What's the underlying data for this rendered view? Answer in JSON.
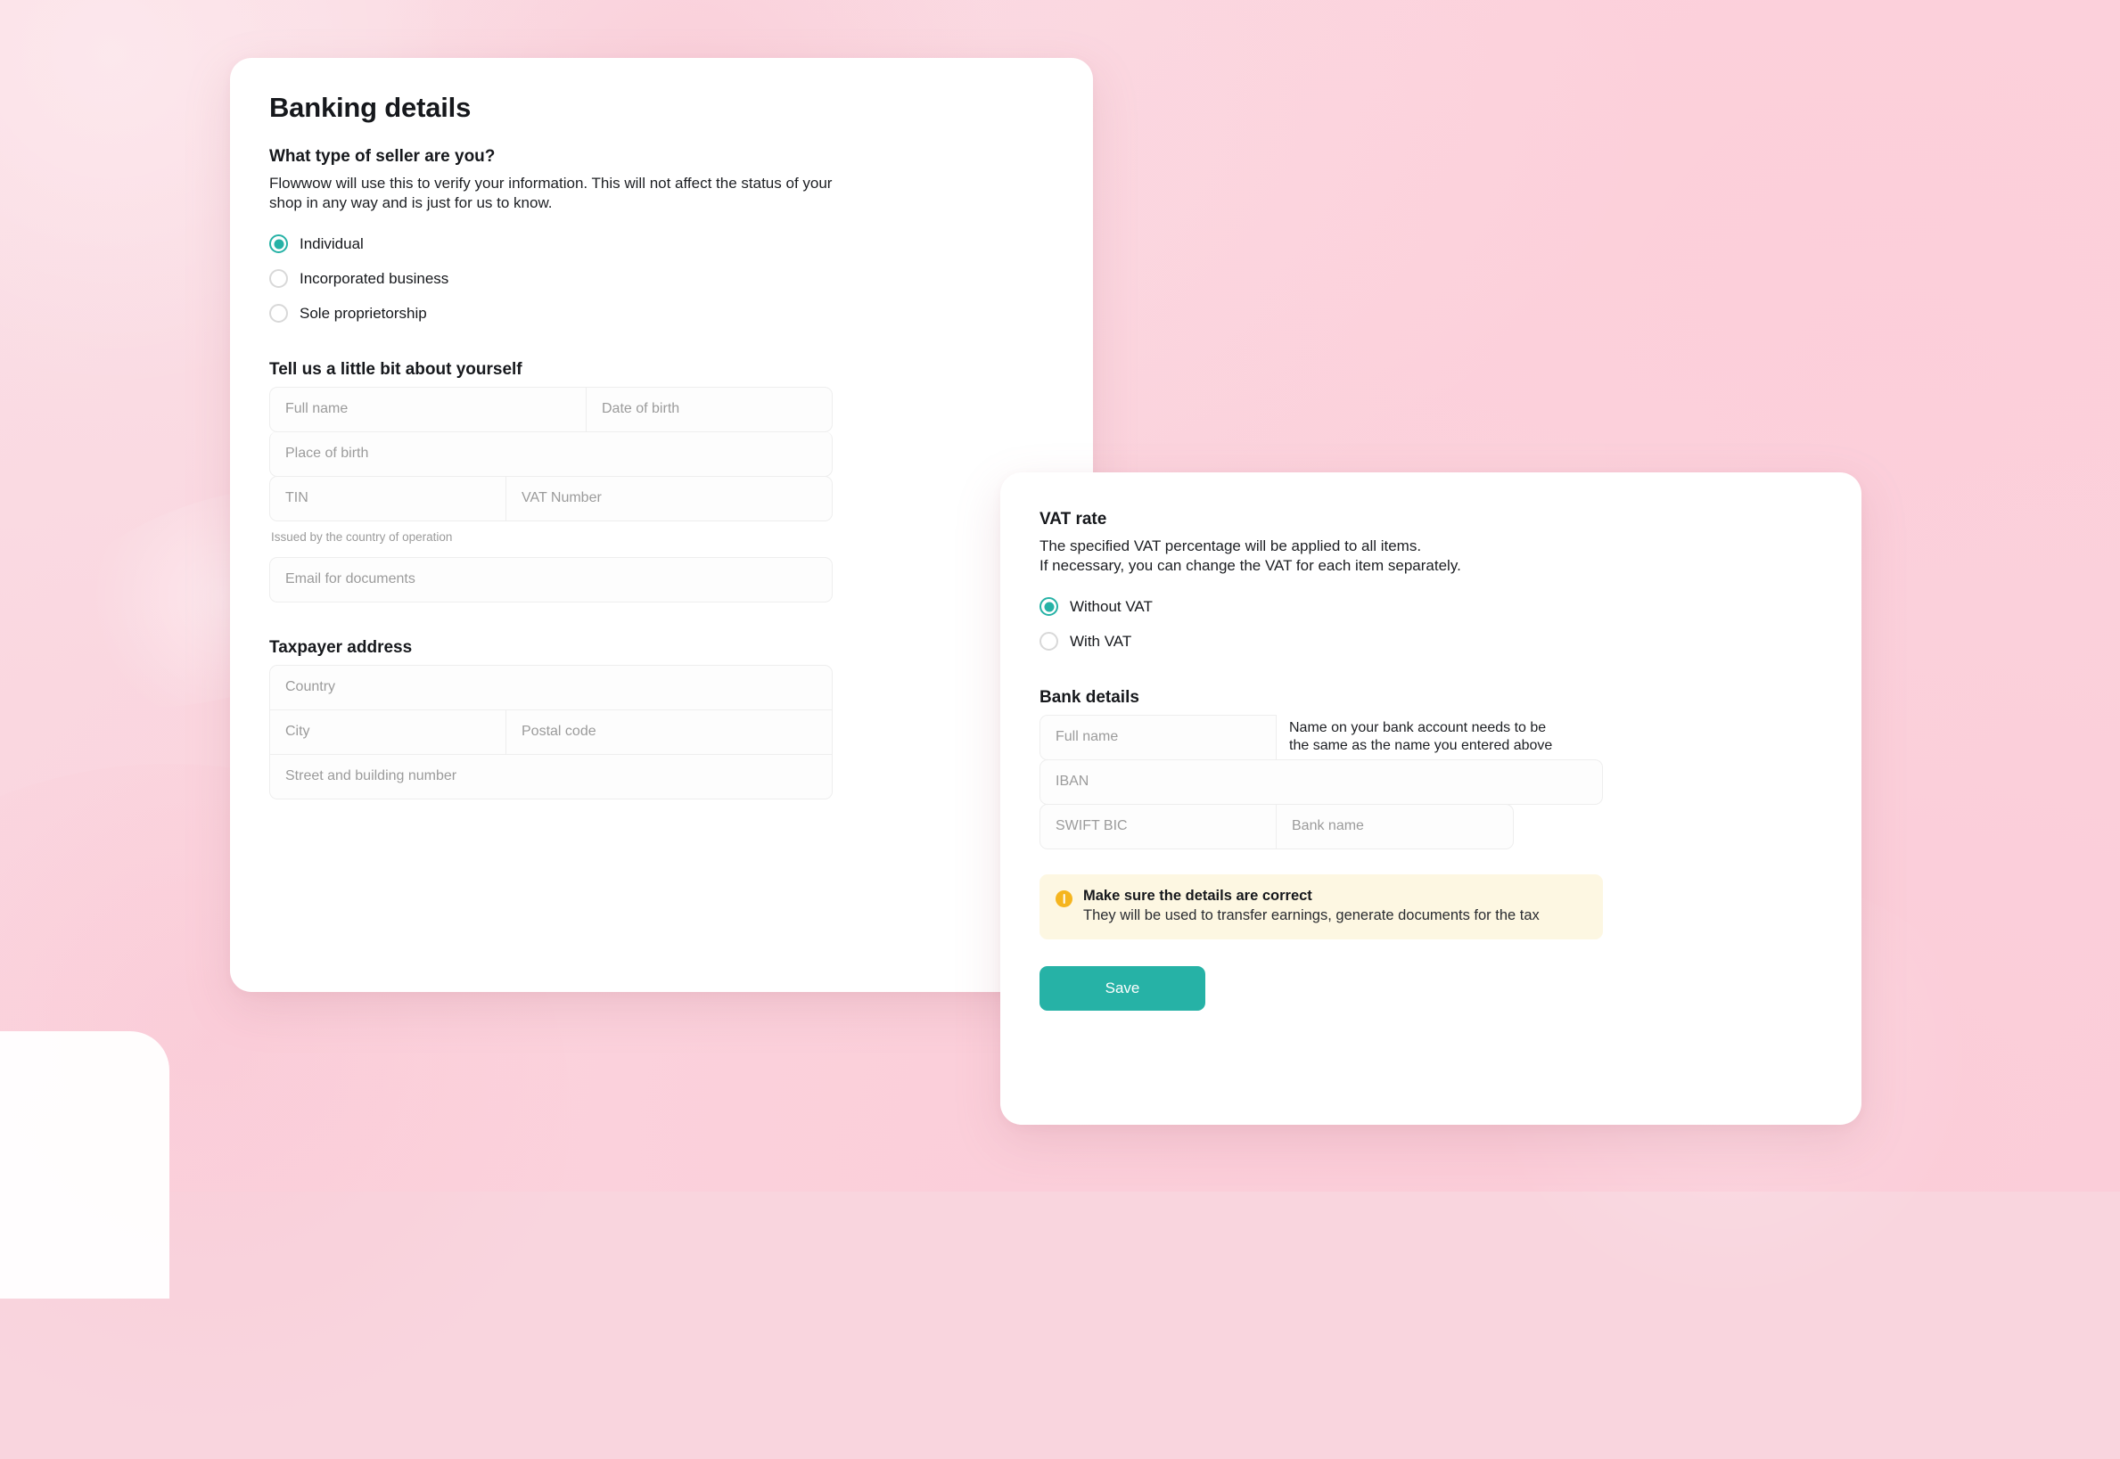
{
  "theme": {
    "accent": "#26b2a6",
    "warning_icon": "#f5b51f",
    "warning_bg": "#fdf7e2",
    "background_pink": "#f9d5de",
    "card_bg": "#ffffff",
    "placeholder": "#9b9b9b"
  },
  "banking_card": {
    "title": "Banking details",
    "seller_type": {
      "heading": "What type of seller are you?",
      "description_line1": "Flowwow will use this to verify your information. This will not affect the status of your",
      "description_line2": "shop in any way and is just for us to know.",
      "options": [
        {
          "label": "Individual",
          "selected": true
        },
        {
          "label": "Incorporated business",
          "selected": false
        },
        {
          "label": "Sole proprietorship",
          "selected": false
        }
      ]
    },
    "about_you": {
      "heading": "Tell us a little bit about yourself",
      "fields": {
        "full_name": "Full name",
        "date_of_birth": "Date of birth",
        "place_of_birth": "Place of birth",
        "tin": "TIN",
        "vat_number": "VAT Number",
        "email_for_documents": "Email for documents"
      },
      "tin_hint": "Issued by the country of operation"
    },
    "taxpayer_address": {
      "heading": "Taxpayer address",
      "fields": {
        "country": "Country",
        "city": "City",
        "postal_code": "Postal code",
        "street": "Street and building number"
      }
    }
  },
  "vat_card": {
    "vat_rate": {
      "heading": "VAT rate",
      "description_line1": "The specified VAT percentage will be applied to all items.",
      "description_line2": "If necessary, you can change the VAT for each item separately.",
      "options": [
        {
          "label": "Without VAT",
          "selected": true
        },
        {
          "label": "With VAT",
          "selected": false
        }
      ]
    },
    "bank_details": {
      "heading": "Bank details",
      "fields": {
        "full_name": "Full name",
        "iban": "IBAN",
        "swift_bic": "SWIFT BIC",
        "bank_name": "Bank name"
      },
      "name_hint_line1": "Name on your bank account needs to be",
      "name_hint_line2": "the same as the name you entered above"
    },
    "warning": {
      "icon": "exclamation-circle-icon",
      "title": "Make sure the details are correct",
      "subtitle": "They will be used to transfer earnings, generate documents for the tax"
    },
    "save_label": "Save"
  }
}
